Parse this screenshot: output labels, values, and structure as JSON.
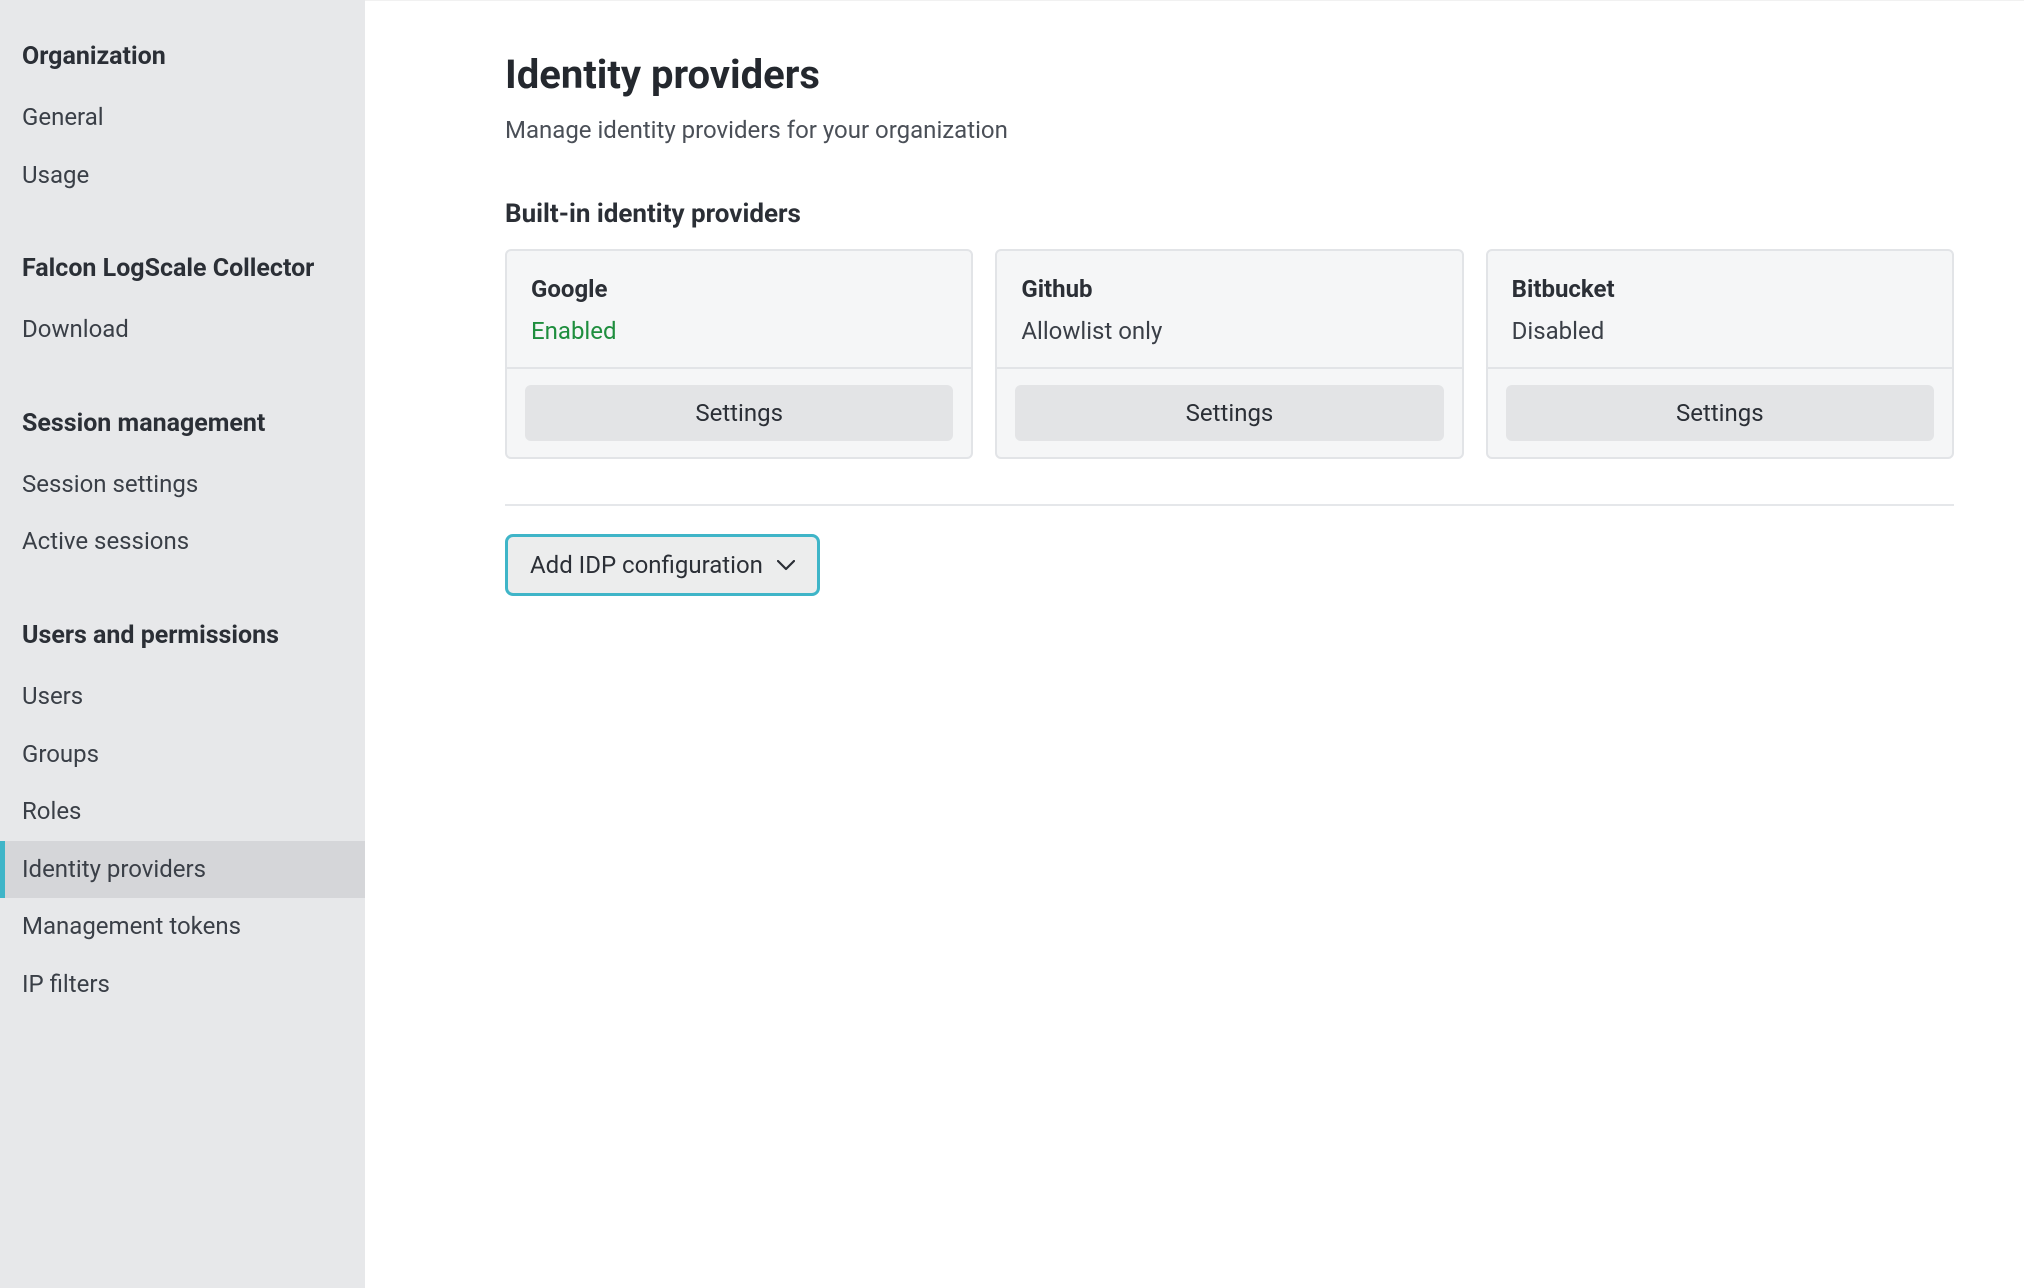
{
  "sidebar": {
    "sections": [
      {
        "heading": "Organization",
        "items": [
          {
            "label": "General",
            "active": false
          },
          {
            "label": "Usage",
            "active": false
          }
        ]
      },
      {
        "heading": "Falcon LogScale Collector",
        "items": [
          {
            "label": "Download",
            "active": false
          }
        ]
      },
      {
        "heading": "Session management",
        "items": [
          {
            "label": "Session settings",
            "active": false
          },
          {
            "label": "Active sessions",
            "active": false
          }
        ]
      },
      {
        "heading": "Users and permissions",
        "items": [
          {
            "label": "Users",
            "active": false
          },
          {
            "label": "Groups",
            "active": false
          },
          {
            "label": "Roles",
            "active": false
          },
          {
            "label": "Identity providers",
            "active": true
          },
          {
            "label": "Management tokens",
            "active": false
          },
          {
            "label": "IP filters",
            "active": false
          }
        ]
      }
    ]
  },
  "main": {
    "title": "Identity providers",
    "subtitle": "Manage identity providers for your organization",
    "section_heading": "Built-in identity providers",
    "providers": [
      {
        "name": "Google",
        "status": "Enabled",
        "status_class": "status-enabled",
        "settings_label": "Settings"
      },
      {
        "name": "Github",
        "status": "Allowlist only",
        "status_class": "status-neutral",
        "settings_label": "Settings"
      },
      {
        "name": "Bitbucket",
        "status": "Disabled",
        "status_class": "status-neutral",
        "settings_label": "Settings"
      }
    ],
    "add_idp_label": "Add IDP configuration"
  }
}
